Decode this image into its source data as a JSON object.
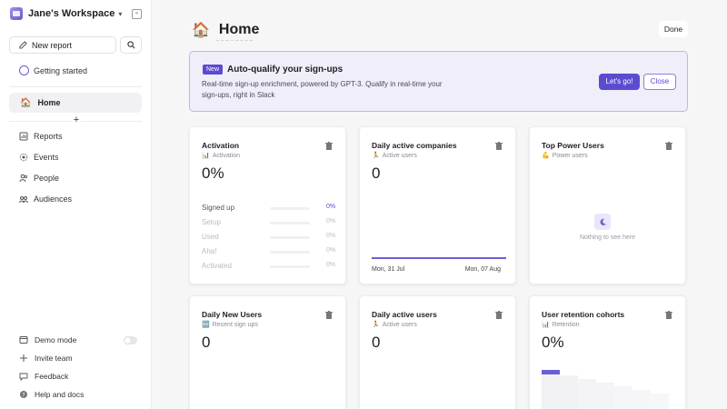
{
  "workspace": {
    "name": "Jane's Workspace"
  },
  "sidebar": {
    "new_report": "New report",
    "getting_started": "Getting started",
    "home": "Home",
    "nav": [
      {
        "label": "Reports",
        "icon": "reports-icon"
      },
      {
        "label": "Events",
        "icon": "events-icon"
      },
      {
        "label": "People",
        "icon": "people-icon"
      },
      {
        "label": "Audiences",
        "icon": "audiences-icon"
      }
    ],
    "bottom": [
      {
        "label": "Demo mode",
        "icon": "demo-icon"
      },
      {
        "label": "Invite team",
        "icon": "plus-icon"
      },
      {
        "label": "Feedback",
        "icon": "feedback-icon"
      },
      {
        "label": "Help and docs",
        "icon": "help-icon"
      }
    ]
  },
  "header": {
    "title": "Home",
    "done": "Done"
  },
  "banner": {
    "badge": "New",
    "title": "Auto-qualify your sign-ups",
    "description": "Real-time sign-up enrichment, powered by GPT-3. Qualify in real-time your sign-ups, right in Slack",
    "primary": "Let's go!",
    "secondary": "Close"
  },
  "cards": {
    "activation": {
      "title": "Activation",
      "subtitle": "Activation",
      "value": "0%",
      "steps": [
        {
          "label": "Signed up",
          "pct": "0%"
        },
        {
          "label": "Setup",
          "pct": "0%"
        },
        {
          "label": "Used",
          "pct": "0%"
        },
        {
          "label": "Aha!",
          "pct": "0%"
        },
        {
          "label": "Activated",
          "pct": "0%"
        }
      ]
    },
    "dac": {
      "title": "Daily active companies",
      "subtitle": "Active users",
      "value": "0",
      "x_start": "Mon, 31 Jul",
      "x_end": "Mon, 07 Aug"
    },
    "power": {
      "title": "Top Power Users",
      "subtitle": "Power users",
      "empty": "Nothing to see here"
    },
    "dnu": {
      "title": "Daily New Users",
      "subtitle": "Recent sign ups",
      "value": "0"
    },
    "dau": {
      "title": "Daily active users",
      "subtitle": "Active users",
      "value": "0"
    },
    "retention": {
      "title": "User retention cohorts",
      "subtitle": "Retention",
      "value": "0%"
    }
  },
  "colors": {
    "accent": "#5a4bd1",
    "banner_bg": "#efeef9"
  }
}
